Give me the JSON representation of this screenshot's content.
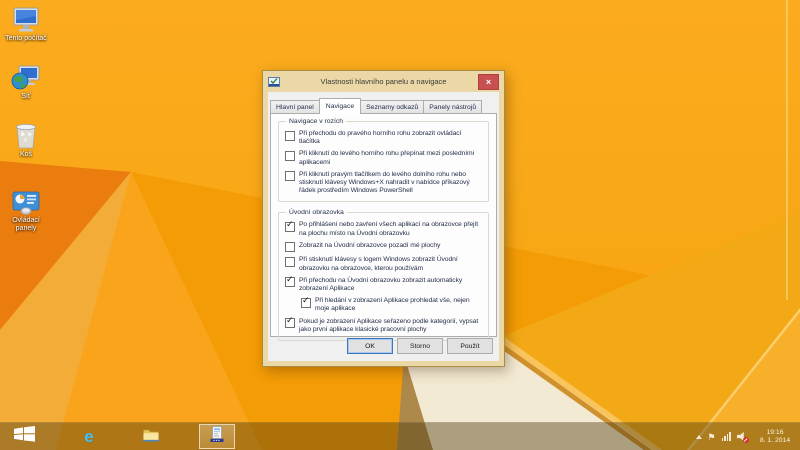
{
  "desktop": {
    "icons": [
      {
        "id": "this-pc",
        "icon": "computer-icon",
        "label": "Tento počítač"
      },
      {
        "id": "network",
        "icon": "network-globe-icon",
        "label": "Síť"
      },
      {
        "id": "recycle-bin",
        "icon": "recycle-bin-icon",
        "label": "Koš"
      },
      {
        "id": "control-panel",
        "icon": "control-panel-icon",
        "label": "Ovládací panely"
      }
    ]
  },
  "dialog": {
    "title": "Vlastnosti hlavního panelu a navigace",
    "close_glyph": "×",
    "check_glyph": "✓",
    "tabs": [
      {
        "id": "hlavni-panel",
        "label": "Hlavní panel",
        "active": false
      },
      {
        "id": "navigace",
        "label": "Navigace",
        "active": true
      },
      {
        "id": "seznamy-odkazu",
        "label": "Seznamy odkazů",
        "active": false
      },
      {
        "id": "panely-nastroju",
        "label": "Panely nástrojů",
        "active": false
      }
    ],
    "groups": [
      {
        "id": "navigace-v-rozich",
        "title": "Navigace v rozích",
        "checkboxes": [
          {
            "label": "Při přechodu do pravého horního rohu zobrazit ovládací tlačítka",
            "checked": false,
            "indent": false
          },
          {
            "label": "Při kliknutí do levého horního rohu přepínat mezi posledními aplikacemi",
            "checked": false,
            "indent": false
          },
          {
            "label": "Při kliknutí pravým tlačítkem do levého dolního rohu nebo stisknutí klávesy Windows+X nahradit v nabídce příkazový řádek prostředím Windows PowerShell",
            "checked": false,
            "indent": false
          }
        ]
      },
      {
        "id": "uvodni-obrazovka",
        "title": "Úvodní obrazovka",
        "checkboxes": [
          {
            "label": "Po přihlášení nebo zavření všech aplikací na obrazovce přejít na plochu místo na Úvodní obrazovku",
            "checked": true,
            "indent": false
          },
          {
            "label": "Zobrazit na Úvodní obrazovce pozadí mé plochy",
            "checked": false,
            "indent": false
          },
          {
            "label": "Při stisknutí klávesy s logem Windows zobrazit Úvodní obrazovku na obrazovce, kterou používám",
            "checked": false,
            "indent": false
          },
          {
            "label": "Při přechodu na Úvodní obrazovku zobrazit automaticky zobrazení Aplikace",
            "checked": true,
            "indent": false
          },
          {
            "label": "Při hledání v zobrazení Aplikace prohledat vše, nejen moje aplikace",
            "checked": true,
            "indent": true
          },
          {
            "label": "Pokud je zobrazení Aplikace seřazeno podle kategorií, vypsat jako první aplikace klasické pracovní plochy",
            "checked": true,
            "indent": false
          }
        ]
      }
    ],
    "buttons": [
      {
        "id": "ok",
        "label": "OK",
        "default": true
      },
      {
        "id": "storno",
        "label": "Storno",
        "default": false
      },
      {
        "id": "pouzit",
        "label": "Použít",
        "default": false
      }
    ]
  },
  "taskbar": {
    "ie_glyph": "e",
    "flag_glyph": "⚑",
    "clock": {
      "time": "19:16",
      "date": "8. 1. 2014"
    }
  },
  "colors": {
    "wallpaper_amber": "#F8A715",
    "wallpaper_dark_orange": "#EB7D0F",
    "wallpaper_gold_wedge": "#F4AC39",
    "wallpaper_cream": "#F3EAD3",
    "window_chrome": "#EBD8A6",
    "close_button_red": "#C85050",
    "dialog_bg": "#F0F0F0",
    "tab_page_bg": "#FDFDFD",
    "dialog_text": "#26304A",
    "ok_focus_border": "#3C77BE",
    "taskbar_tint": "rgba(72,55,14,0.42)"
  }
}
